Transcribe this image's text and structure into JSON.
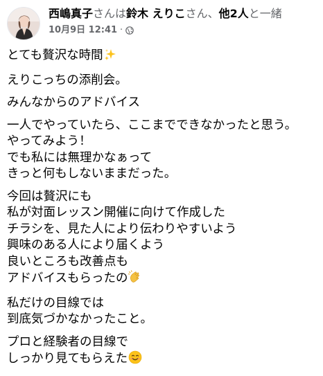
{
  "header": {
    "author": "西嶋真子",
    "with_text": "さんは",
    "tagged_1": "鈴木 えりこ",
    "tagged_mid": "さん、",
    "tagged_others": "他2人",
    "trailing_text": "と一緒",
    "date": "10月9日 12:41",
    "separator": "·",
    "privacy_icon": "globe-icon"
  },
  "post": {
    "paragraphs": [
      {
        "lines": [
          "とても贅沢な時間"
        ],
        "emoji": "sparkles-icon"
      },
      {
        "lines": [
          "えりこっちの添削会。"
        ]
      },
      {
        "lines": [
          "みんなからのアドバイス"
        ]
      },
      {
        "lines": [
          "一人でやっていたら、ここまでできなかったと思う。",
          "やってみよう！",
          "でも私には無理かなぁって",
          "きっと何もしないままだった。"
        ]
      },
      {
        "lines": [
          "今回は贅沢にも",
          "私が対面レッスン開催に向けて作成した",
          "チラシを、見た人により伝わりやすいよう",
          "興味のある人により届くよう",
          "良いところも改善点も",
          "アドバイスもらったの"
        ],
        "emoji": "clapping-hands-icon"
      },
      {
        "lines": [
          "私だけの目線では",
          "到底気づかなかったこと。"
        ]
      },
      {
        "lines": [
          "プロと経験者の目線で",
          "しっかり見てもらえた"
        ],
        "emoji": "smiling-face-icon"
      }
    ]
  },
  "colors": {
    "text": "#050505",
    "secondary": "#65676b",
    "background": "#ffffff"
  }
}
